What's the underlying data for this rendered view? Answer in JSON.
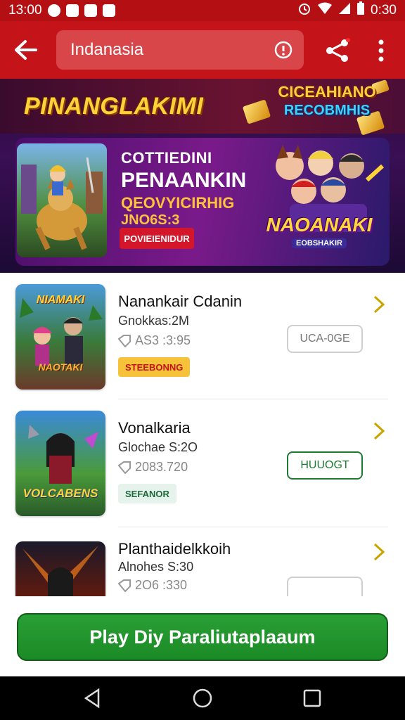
{
  "status_bar": {
    "time": "13:00",
    "right_time": "0:30"
  },
  "app_bar": {
    "search_text": "Indanasia"
  },
  "banner": {
    "title": "PINANGLAKIMI",
    "badge_line1": "CICEAHIANO",
    "badge_line2": "RECOBMHIS",
    "promo": {
      "line1": "COTTIEDINI",
      "line2": "PENAANKIN",
      "line3": "QEOVYICIRHIG",
      "line4": "JNO6S:3",
      "button": "POVIEIENIDUR",
      "logo_title": "NAOANAKI",
      "logo_sub": "EOBSHAKIR"
    }
  },
  "games": [
    {
      "thumb_label": "NIAMAKI",
      "thumb_sub": "NAOTAKI",
      "title": "Nanankair Cdanin",
      "subtitle": "Gnokkas:2M",
      "meta": "AS3 :3:95",
      "tag": "STEEBONNG",
      "action": "UCA-0GE"
    },
    {
      "thumb_label": "VOLCABENS",
      "thumb_sub": "",
      "title": "Vonalkaria",
      "subtitle": "Glochae S:2O",
      "meta": "2083.720",
      "tag": "SEFANOR",
      "action": "HUUOGT"
    },
    {
      "thumb_label": "",
      "thumb_sub": "",
      "title": "Planthaidelkkoih",
      "subtitle": "Alnohes S:30",
      "meta": "2O6 :330",
      "tag": "",
      "action": ""
    }
  ],
  "play_button": "Play Diy Paraliutaplaaum",
  "colors": {
    "red_header": "#c41419",
    "play_green": "#1e8f2a",
    "tag_yellow": "#f5c23a",
    "tag_green_bg": "#e6f2ec",
    "action_green": "#1e7a32"
  }
}
